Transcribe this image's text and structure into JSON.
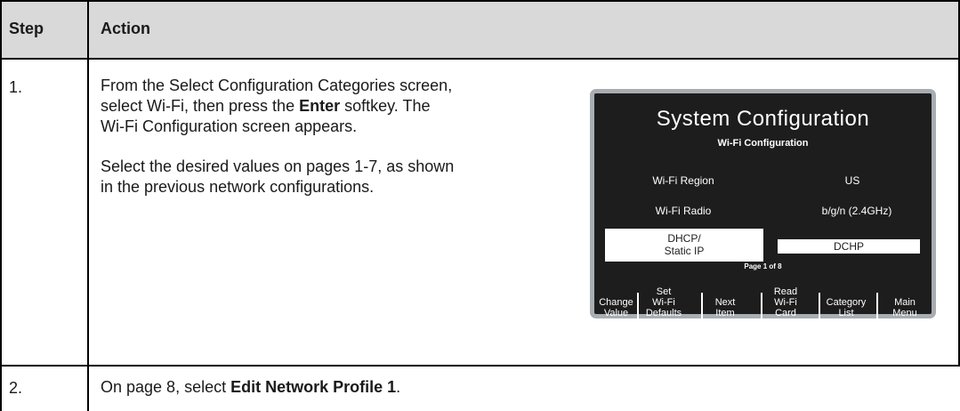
{
  "table": {
    "header": {
      "step": "Step",
      "action": "Action"
    },
    "rows": [
      {
        "step": "1.",
        "line1": "From the Select Configuration Categories screen,",
        "line2_pre": "select Wi-Fi, then press the ",
        "line2_bold": "Enter",
        "line2_post": " softkey. The",
        "line3": "Wi-Fi Configuration screen appears.",
        "para2_line1": "Select the desired values on pages 1-7, as shown",
        "para2_line2": "in the previous network configurations."
      },
      {
        "step": "2.",
        "text_pre": "On page 8, select ",
        "text_bold": "Edit Network Profile 1",
        "text_post": "."
      }
    ]
  },
  "device": {
    "title": "System Configuration",
    "subtitle": "Wi-Fi Configuration",
    "fields": [
      {
        "label": "Wi-Fi Region",
        "value": "US"
      },
      {
        "label": "Wi-Fi Radio",
        "value": "b/g/n (2.4GHz)"
      }
    ],
    "selected_label_line1": "DHCP/",
    "selected_label_line2": "Static IP",
    "selected_value": "DCHP",
    "page_indicator": "Page 1 of 8",
    "softkeys": [
      {
        "line1": "",
        "line2": "Change",
        "line3": "Value"
      },
      {
        "line1": "Set",
        "line2": "Wi-Fi",
        "line3": "Defaults"
      },
      {
        "line1": "",
        "line2": "Next",
        "line3": "Item"
      },
      {
        "line1": "Read",
        "line2": "Wi-Fi",
        "line3": "Card"
      },
      {
        "line1": "",
        "line2": "Category",
        "line3": "List"
      },
      {
        "line1": "",
        "line2": "Main",
        "line3": "Menu"
      }
    ]
  }
}
